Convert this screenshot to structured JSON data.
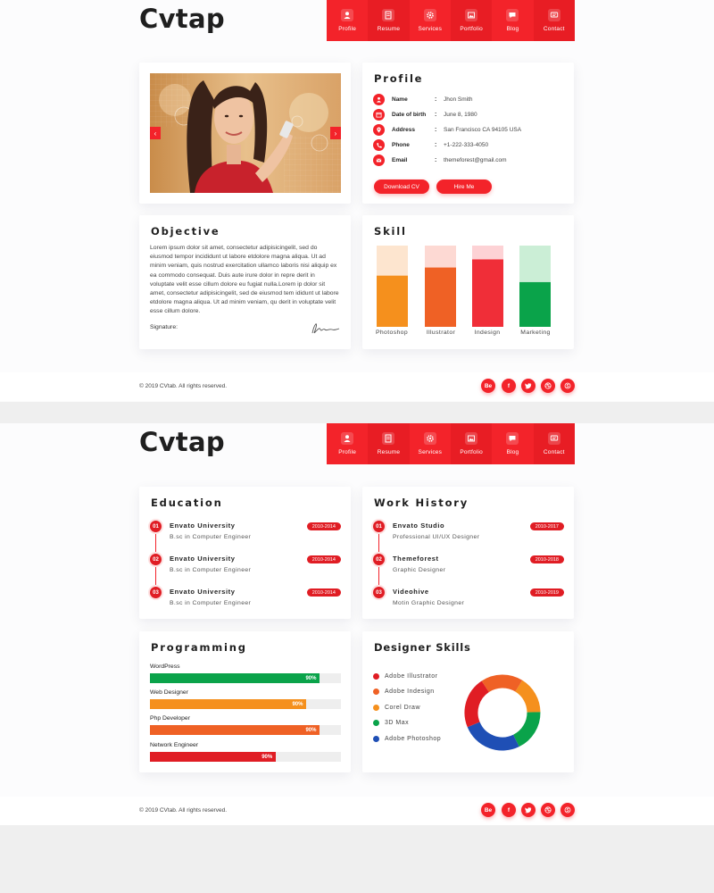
{
  "brand": {
    "logo": "Cvtap",
    "accent": "#f3232a"
  },
  "nav": [
    {
      "label": "Profile",
      "icon": "user-icon"
    },
    {
      "label": "Resume",
      "icon": "document-icon"
    },
    {
      "label": "Services",
      "icon": "gear-icon"
    },
    {
      "label": "Portfolio",
      "icon": "image-icon"
    },
    {
      "label": "Blog",
      "icon": "chat-icon"
    },
    {
      "label": "Contact",
      "icon": "message-icon"
    }
  ],
  "profile": {
    "title": "Profile",
    "rows": [
      {
        "label": "Name",
        "value": "Jhon Smith",
        "icon": "person-icon"
      },
      {
        "label": "Date of birth",
        "value": "June 8, 1980",
        "icon": "calendar-icon"
      },
      {
        "label": "Address",
        "value": "San Francisco CA 94105 USA",
        "icon": "location-icon"
      },
      {
        "label": "Phone",
        "value": "+1-222-333-4050",
        "icon": "phone-icon"
      },
      {
        "label": "Email",
        "value": "themeforest@gmail.com",
        "icon": "mail-icon"
      }
    ],
    "download_label": "Download CV",
    "hire_label": "Hire Me"
  },
  "objective": {
    "title": "Objective",
    "text": "Lorem ipsum dolor sit amet, consectetur adipisicingelit, sed do eiusmod tempor incididunt ut labore etdolore magna aliqua. Ut ad minim veniam, quis nostrud exercitation ullamco laboris nisi aliquip ex ea commodo consequat. Duis aute irure dolor in repre derit in voluptate velit esse cillum dolore eu fugiat nulla.Lorem ip dolor sit amet, consectetur adipisicingelit, sed de  eiusmod tem ididunt ut labore etdolore magna aliqua. Ut ad minim veniam, qu derit in voluptate velit esse cillum dolore.",
    "signature_label": "Signature:"
  },
  "skill": {
    "title": "Skill",
    "items": [
      {
        "label": "Photoshop",
        "fraction": 0.63,
        "color": "#f5901d",
        "track": "#fde5cf"
      },
      {
        "label": "Illustrator",
        "fraction": 0.73,
        "color": "#ef6125",
        "track": "#fdd9d3"
      },
      {
        "label": "Indesign",
        "fraction": 0.83,
        "color": "#f02e38",
        "track": "#fdd2d5"
      },
      {
        "label": "Marketing",
        "fraction": 0.55,
        "color": "#0aa34a",
        "track": "#cbeed6"
      }
    ]
  },
  "footer": {
    "copyright": "© 2019 CVtab. All rights reserved.",
    "social": [
      {
        "label": "Be",
        "icon": "behance-icon"
      },
      {
        "label": "f",
        "icon": "facebook-icon"
      },
      {
        "label": "",
        "icon": "twitter-icon"
      },
      {
        "label": "",
        "icon": "dribbble-icon"
      },
      {
        "label": "",
        "icon": "skype-icon"
      }
    ]
  },
  "education": {
    "title": "Education",
    "items": [
      {
        "num": "01",
        "title": "Envato University",
        "sub": "B.sc in Computer Engineer",
        "date": "2010-2014"
      },
      {
        "num": "02",
        "title": "Envato University",
        "sub": "B.sc in Computer Engineer",
        "date": "2010-2014"
      },
      {
        "num": "03",
        "title": "Envato University",
        "sub": "B.sc in Computer Engineer",
        "date": "2010-2014"
      }
    ]
  },
  "work": {
    "title": "Work History",
    "items": [
      {
        "num": "01",
        "title": "Envato Studio",
        "sub": "Professional UI/UX Designer",
        "date": "2010-2017"
      },
      {
        "num": "02",
        "title": "Themeforest",
        "sub": "Graphic Designer",
        "date": "2010-2018"
      },
      {
        "num": "03",
        "title": "Videohive",
        "sub": "Motin Graphic Designer",
        "date": "2010-2019"
      }
    ]
  },
  "programming": {
    "title": "Programming",
    "items": [
      {
        "label": "WordPress",
        "fraction": 0.89,
        "value_label": "90%",
        "color": "#0aa34a"
      },
      {
        "label": "Web Designer",
        "fraction": 0.82,
        "value_label": "90%",
        "color": "#f5901d"
      },
      {
        "label": "Php Developer",
        "fraction": 0.89,
        "value_label": "90%",
        "color": "#ef6125"
      },
      {
        "label": "Network Engineer",
        "fraction": 0.66,
        "value_label": "90%",
        "color": "#e01d24"
      }
    ]
  },
  "designer": {
    "title": "Designer Skills",
    "items": [
      {
        "label": "Adobe Illustrator",
        "color": "#e01d24"
      },
      {
        "label": "Adobe Indesign",
        "color": "#ef6125"
      },
      {
        "label": "Corel Draw",
        "color": "#f5901d"
      },
      {
        "label": "3D Max",
        "color": "#0aa34a"
      },
      {
        "label": "Adobe Photoshop",
        "color": "#1f4fb5"
      }
    ],
    "donut_segments": [
      {
        "color": "#f5901d",
        "fraction": 0.16
      },
      {
        "color": "#0aa34a",
        "fraction": 0.18
      },
      {
        "color": "#1f4fb5",
        "fraction": 0.26
      },
      {
        "color": "#e01d24",
        "fraction": 0.22
      },
      {
        "color": "#ef6125",
        "fraction": 0.18
      }
    ]
  }
}
